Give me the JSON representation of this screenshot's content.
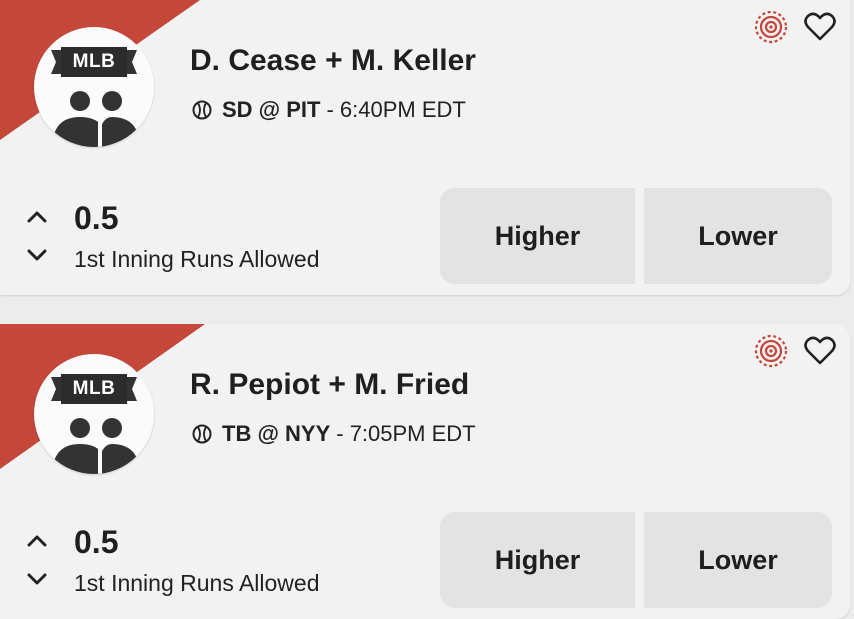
{
  "colors": {
    "accent": "#c4473a",
    "card_bg": "#f2f2f2",
    "button_bg": "#e3e3e3"
  },
  "cards": [
    {
      "league": "MLB",
      "players": "D. Cease + M. Keller",
      "matchup": "SD @ PIT",
      "time": "- 6:40PM EDT",
      "line": "0.5",
      "stat": "1st Inning Runs Allowed",
      "higher_label": "Higher",
      "lower_label": "Lower"
    },
    {
      "league": "MLB",
      "players": "R. Pepiot + M. Fried",
      "matchup": "TB @ NYY",
      "time": "- 7:05PM EDT",
      "line": "0.5",
      "stat": "1st Inning Runs Allowed",
      "higher_label": "Higher",
      "lower_label": "Lower"
    }
  ],
  "icons": [
    "target-icon",
    "heart-icon",
    "baseball-icon",
    "chevron-up-icon",
    "chevron-down-icon",
    "people-icon"
  ]
}
